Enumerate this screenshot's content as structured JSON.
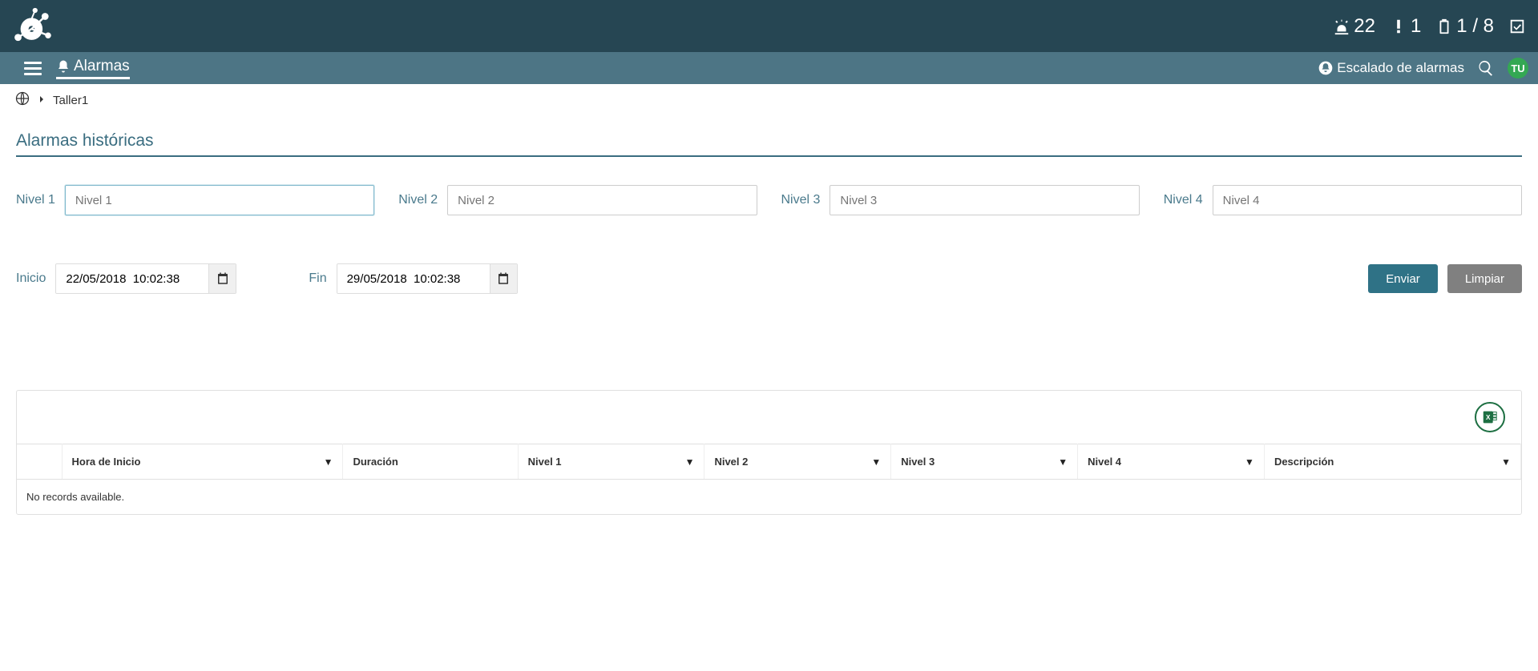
{
  "header": {
    "stats": {
      "alarm_count": "22",
      "warn_count": "1",
      "battery_ratio": "1 / 8"
    }
  },
  "subheader": {
    "page_title": "Alarmas",
    "escalado_label": "Escalado de alarmas",
    "avatar_initials": "TU"
  },
  "breadcrumb": {
    "location": "Taller1"
  },
  "section": {
    "title": "Alarmas históricas"
  },
  "filters": {
    "nivel1": {
      "label": "Nivel 1",
      "placeholder": "Nivel 1"
    },
    "nivel2": {
      "label": "Nivel 2",
      "placeholder": "Nivel 2"
    },
    "nivel3": {
      "label": "Nivel 3",
      "placeholder": "Nivel 3"
    },
    "nivel4": {
      "label": "Nivel 4",
      "placeholder": "Nivel 4"
    }
  },
  "dates": {
    "inicio_label": "Inicio",
    "inicio_value": "22/05/2018  10:02:38",
    "fin_label": "Fin",
    "fin_value": "29/05/2018  10:02:38"
  },
  "buttons": {
    "enviar": "Enviar",
    "limpiar": "Limpiar"
  },
  "table": {
    "columns": {
      "hora_inicio": "Hora de Inicio",
      "duracion": "Duración",
      "nivel1": "Nivel 1",
      "nivel2": "Nivel 2",
      "nivel3": "Nivel 3",
      "nivel4": "Nivel 4",
      "descripcion": "Descripción"
    },
    "no_records": "No records available."
  }
}
